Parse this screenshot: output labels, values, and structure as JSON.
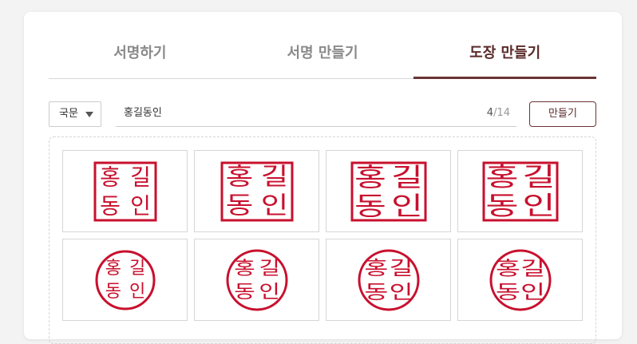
{
  "tabs": [
    {
      "label": "서명하기",
      "active": false
    },
    {
      "label": "서명 만들기",
      "active": false
    },
    {
      "label": "도장 만들기",
      "active": true
    }
  ],
  "toolbar": {
    "script_select": "국문",
    "name_input": "홍길동인",
    "char_count": "4",
    "char_max": "/14",
    "make_button": "만들기"
  },
  "stamps": {
    "color": "#c8102e",
    "square_row": [
      {
        "chars": [
          "홍",
          "길",
          "동",
          "인"
        ]
      },
      {
        "chars": [
          "홍",
          "길",
          "동",
          "인"
        ]
      },
      {
        "chars": [
          "홍",
          "길",
          "동",
          "인"
        ]
      },
      {
        "chars": [
          "홍",
          "길",
          "동",
          "인"
        ]
      }
    ],
    "round_row": [
      {
        "chars": [
          "홍",
          "길",
          "동",
          "인"
        ]
      },
      {
        "chars": [
          "홍",
          "길",
          "동",
          "인"
        ]
      },
      {
        "chars": [
          "홍",
          "길",
          "동",
          "인"
        ]
      },
      {
        "chars": [
          "홍",
          "길",
          "동",
          "인"
        ]
      }
    ]
  }
}
